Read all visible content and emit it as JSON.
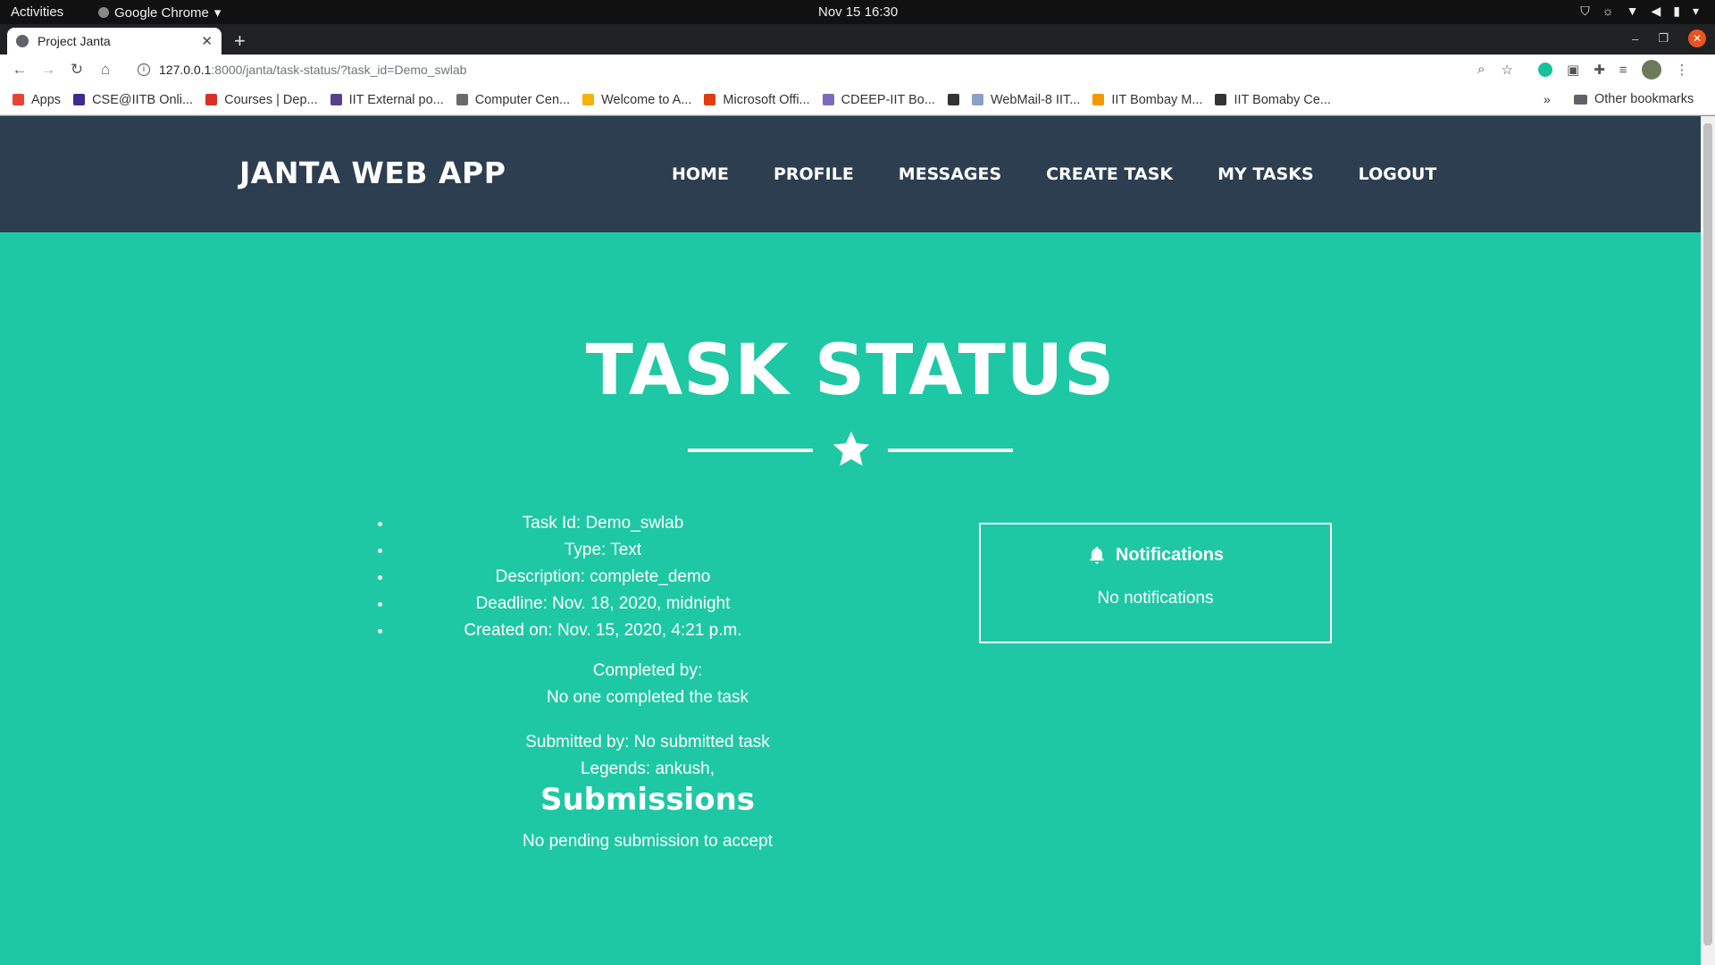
{
  "system": {
    "activities": "Activities",
    "app_name": "Google Chrome",
    "clock": "Nov 15  16:30"
  },
  "browser": {
    "tab_title": "Project Janta",
    "url_host": "127.0.0.1",
    "url_path": ":8000/janta/task-status/?task_id=Demo_swlab",
    "bookmarks": [
      {
        "label": "Apps",
        "color": "#e94235"
      },
      {
        "label": "CSE@IITB Onli...",
        "color": "#3f2a91"
      },
      {
        "label": "Courses | Dep...",
        "color": "#d93025"
      },
      {
        "label": "IIT External po...",
        "color": "#5a3e8e"
      },
      {
        "label": "Computer Cen...",
        "color": "#6b6b6b"
      },
      {
        "label": "Welcome to A...",
        "color": "#f4b400"
      },
      {
        "label": "Microsoft Offi...",
        "color": "#e03c10"
      },
      {
        "label": "CDEEP-IIT Bo...",
        "color": "#7c6bbd"
      },
      {
        "label": "",
        "color": "#333333"
      },
      {
        "label": "WebMail-8 IIT...",
        "color": "#8aa0c8"
      },
      {
        "label": "IIT Bombay M...",
        "color": "#f29900"
      },
      {
        "label": "IIT Bomaby Ce...",
        "color": "#333333"
      }
    ],
    "bookmarks_more": "»",
    "other_bookmarks": "Other bookmarks"
  },
  "site": {
    "brand": "JANTA WEB APP",
    "menu": [
      "HOME",
      "PROFILE",
      "MESSAGES",
      "CREATE TASK",
      "MY TASKS",
      "LOGOUT"
    ]
  },
  "task": {
    "page_title": "TASK STATUS",
    "details": [
      "Task Id: Demo_swlab",
      "Type: Text",
      "Description: complete_demo",
      "Deadline: Nov. 18, 2020, midnight",
      "Created on: Nov. 15, 2020, 4:21 p.m."
    ],
    "completed_by_label": "Completed by:",
    "completed_by_value": "No one completed the task",
    "submitted_by": "Submitted by: No submitted task",
    "legends": "Legends: ankush,",
    "submissions_title": "Submissions",
    "submissions_empty": "No pending submission to accept"
  },
  "notifications": {
    "title": "Notifications",
    "empty": "No notifications"
  },
  "colors": {
    "page_bg": "#1ec8a4",
    "nav_bg": "#2c3e50"
  }
}
